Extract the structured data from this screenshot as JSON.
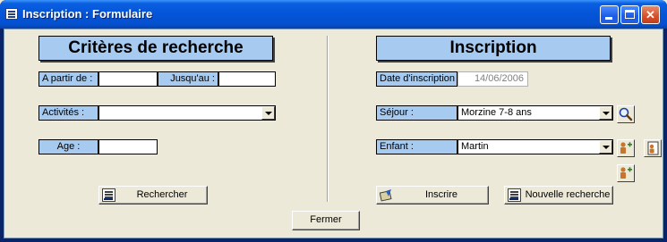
{
  "window": {
    "title": "Inscription : Formulaire"
  },
  "search": {
    "header": "Critères de recherche",
    "from_label": "A partir de :",
    "from_value": "",
    "until_label": "Jusqu'au :",
    "until_value": "",
    "activities_label": "Activités :",
    "activities_value": "",
    "age_label": "Age :",
    "age_value": "",
    "search_button": "Rechercher"
  },
  "registration": {
    "header": "Inscription",
    "date_label": "Date d'inscription :",
    "date_value": "14/06/2006",
    "stay_label": "Séjour :",
    "stay_value": "Morzine 7-8 ans",
    "child_label": "Enfant :",
    "child_value": "Martin",
    "register_button": "Inscrire",
    "new_search_button": "Nouvelle recherche"
  },
  "footer": {
    "close_button": "Fermer"
  },
  "icons": {
    "window": "form-icon",
    "search": "magnifier-icon",
    "add_child": "add-person-icon",
    "edit_child": "edit-person-icon",
    "add_child_2": "add-person-icon",
    "register": "checkbook-icon",
    "new_search": "form-icon"
  },
  "colors": {
    "label_bg": "#a6caf0",
    "titlebar": "#0454d8",
    "window_bg": "#ece9d8"
  }
}
